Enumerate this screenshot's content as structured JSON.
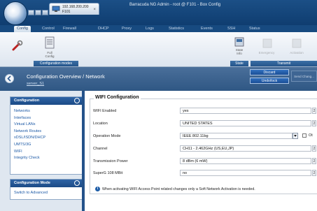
{
  "window": {
    "title": "Barracuda NG Admin - root @ F101 - Box Config",
    "connection_ip": "192.168.200.200",
    "connection_name": "F101",
    "close_glyph": "×"
  },
  "menu": [
    "Config",
    "Control",
    "Firewall",
    "DHCP",
    "Proxy",
    "Logs",
    "Statistics",
    "Events",
    "SSH",
    "Status"
  ],
  "toolbar": {
    "full_config_label": "Full\nConfig",
    "config_modes_label": "Configuration modes",
    "state_info_label": "State\nInfo",
    "state_label": "State",
    "transmit_label": "Transmit",
    "disabled_labels": [
      "Emergency",
      "Activation"
    ]
  },
  "header": {
    "title": "Configuration Overview / Network",
    "subtitle": "server_S1",
    "discard": "Discard",
    "undo": "Undo/lock",
    "send": "Send Chang..."
  },
  "sidebar": {
    "configuration_title": "Configuration",
    "items": [
      "Networks",
      "Interfaces",
      "Virtual LANs",
      "Network Routes",
      "xDSL/ISDN/DHCP",
      "UMTS/3G",
      "WIFI",
      "Integrity Check"
    ],
    "mode_title": "Configuration Mode",
    "mode_items": [
      "Switch to Advanced"
    ]
  },
  "wifi": {
    "legend": "WIFI Configuration",
    "rows": [
      {
        "label": "WIFI Enabled",
        "value": "yes"
      },
      {
        "label": "Location",
        "value": "UNITED STATES"
      },
      {
        "label": "Operation Mode",
        "value": "IEEE 802.11bg"
      },
      {
        "label": "Channel",
        "value": "CH11 - 2.462GHz (US,EU,JP)"
      },
      {
        "label": "Transmission Power",
        "value": "8  dBm (6 mW)"
      },
      {
        "label": "SuperG 108 MBit",
        "value": "no"
      }
    ],
    "other_checkbox_label": "Ot",
    "info_text": "When activating WIFI Access Point related changes only a Soft Network Activation is needed."
  },
  "colors": {
    "accent": "#1b4f86",
    "link": "#1d5aa6",
    "header_band": "#3b6390"
  },
  "icons": [
    "barracuda-logo-icon",
    "monitor-icon",
    "wrench-icon",
    "full-config-icon",
    "state-info-icon",
    "emergency-icon",
    "activation-icon",
    "back-arrow-icon",
    "info-icon"
  ]
}
